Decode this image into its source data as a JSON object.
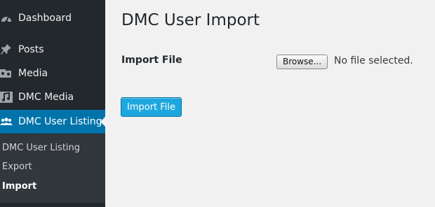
{
  "sidebar": {
    "items": [
      {
        "label": "Dashboard",
        "icon": "dashboard-icon"
      },
      {
        "label": "Posts",
        "icon": "pin-icon"
      },
      {
        "label": "Media",
        "icon": "media-icon"
      },
      {
        "label": "DMC Media",
        "icon": "music-icon"
      },
      {
        "label": "DMC User Listing",
        "icon": "users-icon",
        "current": true
      }
    ],
    "submenu": [
      {
        "label": "DMC User Listing"
      },
      {
        "label": "Export"
      },
      {
        "label": "Import",
        "active": true
      }
    ]
  },
  "main": {
    "title": "DMC User Import",
    "import_file_label": "Import File",
    "browse_label": "Browse...",
    "file_status": "No file selected.",
    "import_button_label": "Import File"
  },
  "colors": {
    "sidebar_bg": "#23282d",
    "submenu_bg": "#32373c",
    "current_menu_bg": "#0073aa",
    "primary_button": "#1ea7de",
    "page_bg": "#f1f1f1"
  }
}
